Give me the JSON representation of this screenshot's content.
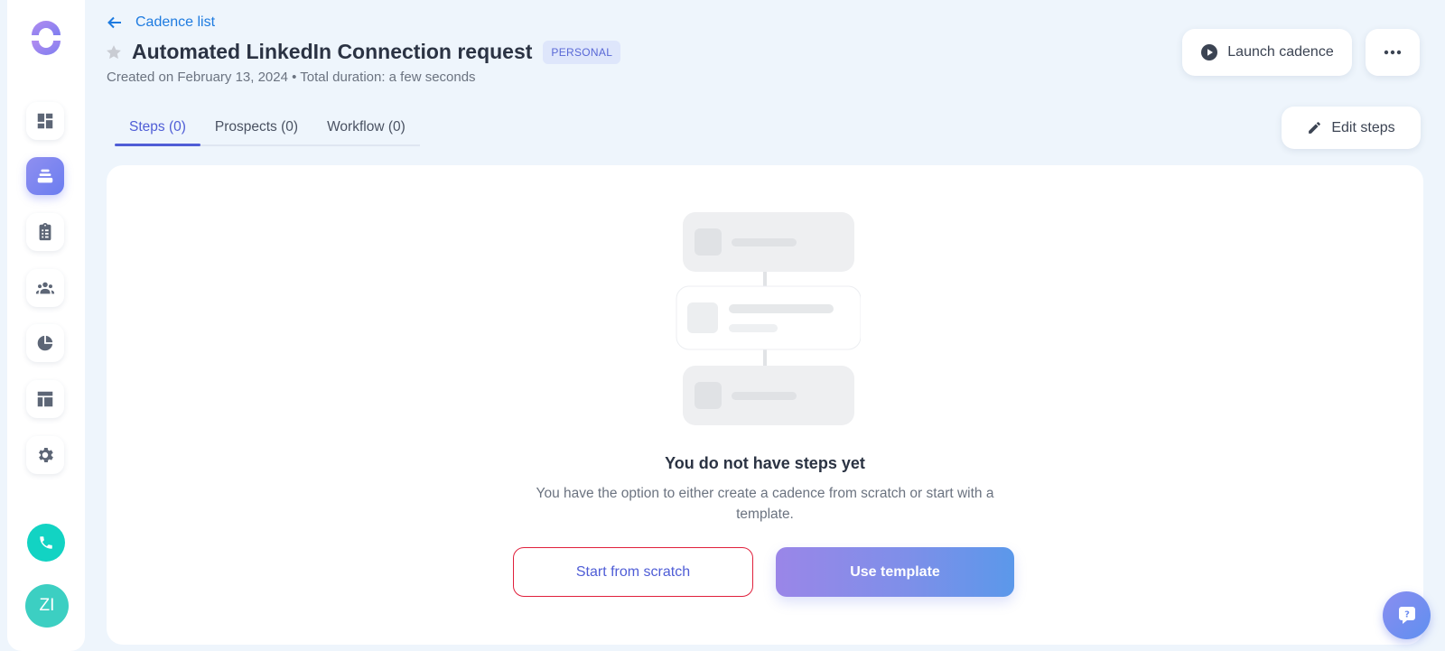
{
  "header": {
    "back_label": "Cadence list",
    "title": "Automated LinkedIn Connection request",
    "badge": "PERSONAL",
    "subtitle": "Created on February 13, 2024 • Total duration: a few seconds",
    "launch_label": "Launch cadence",
    "edit_label": "Edit steps"
  },
  "tabs": [
    {
      "label": "Steps (0)",
      "active": true
    },
    {
      "label": "Prospects (0)",
      "active": false
    },
    {
      "label": "Workflow (0)",
      "active": false
    }
  ],
  "sidebar": {
    "items": [
      {
        "icon": "dashboard-icon"
      },
      {
        "icon": "cadences-icon",
        "active": true
      },
      {
        "icon": "tasks-icon"
      },
      {
        "icon": "prospects-icon"
      },
      {
        "icon": "reports-icon"
      },
      {
        "icon": "templates-icon"
      },
      {
        "icon": "settings-icon"
      }
    ],
    "phone_icon": "phone-icon",
    "avatar_initials": "ZI"
  },
  "empty_state": {
    "title": "You do not have steps yet",
    "description": "You have the option to either create a cadence from scratch or start with a template.",
    "scratch_label": "Start from scratch",
    "template_label": "Use template"
  },
  "colors": {
    "accent": "#4f5dd6",
    "link": "#1e7be0",
    "phone": "#12d3c3",
    "avatar": "#3ccfc2",
    "background": "#eef5fc"
  }
}
